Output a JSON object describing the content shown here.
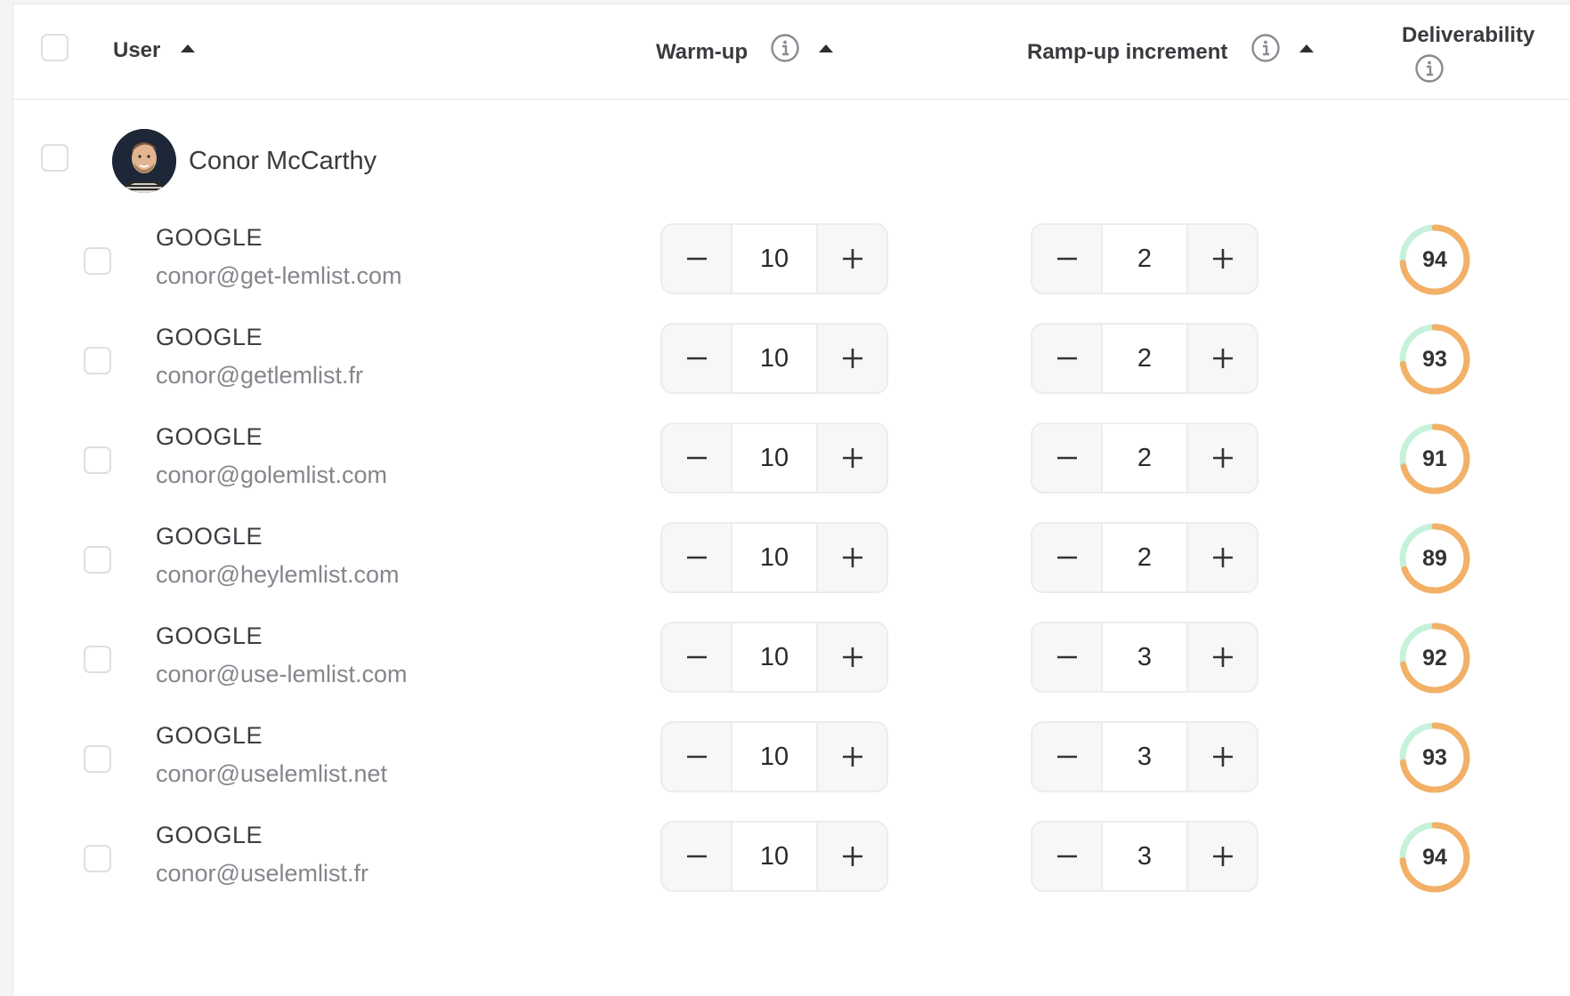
{
  "header": {
    "user_label": "User",
    "warmup_label": "Warm-up",
    "rampup_label": "Ramp-up increment",
    "deliverability_label": "Deliverability"
  },
  "user": {
    "name": "Conor McCarthy"
  },
  "accounts": [
    {
      "provider": "GOOGLE",
      "email": "conor@get-lemlist.com",
      "warmup": "10",
      "rampup": "2",
      "deliverability": "94",
      "score_fraction": 0.94
    },
    {
      "provider": "GOOGLE",
      "email": "conor@getlemlist.fr",
      "warmup": "10",
      "rampup": "2",
      "deliverability": "93",
      "score_fraction": 0.93
    },
    {
      "provider": "GOOGLE",
      "email": "conor@golemlist.com",
      "warmup": "10",
      "rampup": "2",
      "deliverability": "91",
      "score_fraction": 0.91
    },
    {
      "provider": "GOOGLE",
      "email": "conor@heylemlist.com",
      "warmup": "10",
      "rampup": "2",
      "deliverability": "89",
      "score_fraction": 0.89
    },
    {
      "provider": "GOOGLE",
      "email": "conor@use-lemlist.com",
      "warmup": "10",
      "rampup": "3",
      "deliverability": "92",
      "score_fraction": 0.92
    },
    {
      "provider": "GOOGLE",
      "email": "conor@uselemlist.net",
      "warmup": "10",
      "rampup": "3",
      "deliverability": "93",
      "score_fraction": 0.93
    },
    {
      "provider": "GOOGLE",
      "email": "conor@uselemlist.fr",
      "warmup": "10",
      "rampup": "3",
      "deliverability": "94",
      "score_fraction": 0.94
    }
  ],
  "colors": {
    "score_orange": "#f3b067",
    "score_mint": "#c6f2dc"
  }
}
